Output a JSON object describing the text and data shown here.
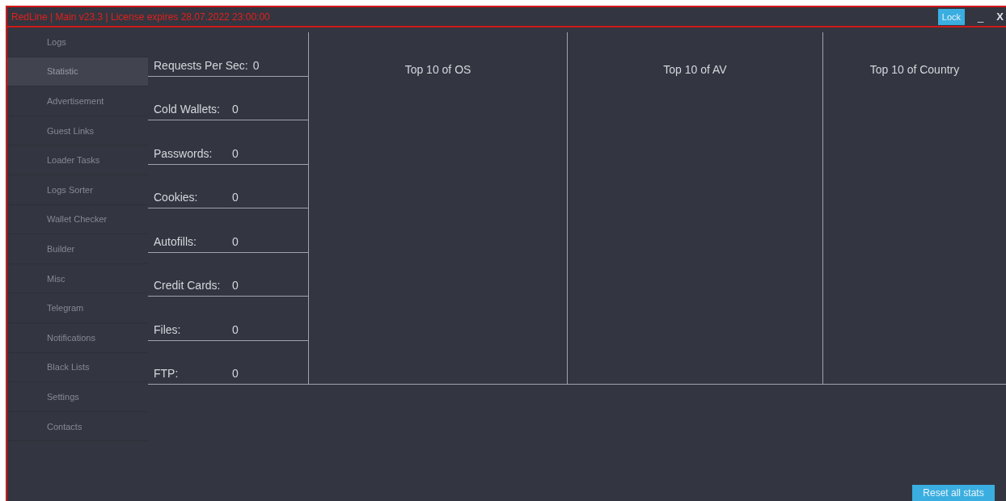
{
  "window": {
    "title": "RedLine | Main v23.3 | License expires 28.07.2022 23:00:00",
    "buttons": [
      {
        "kind": "lock",
        "label": "Lock"
      },
      {
        "kind": "minimize",
        "label": "_"
      },
      {
        "kind": "close",
        "label": "X"
      }
    ]
  },
  "sidebar": {
    "items": [
      {
        "label": "Logs",
        "selected": false
      },
      {
        "label": "Statistic",
        "selected": true
      },
      {
        "label": "Advertisement",
        "selected": false
      },
      {
        "label": "Guest Links",
        "selected": false
      },
      {
        "label": "Loader Tasks",
        "selected": false
      },
      {
        "label": "Logs Sorter",
        "selected": false
      },
      {
        "label": "Wallet Checker",
        "selected": false
      },
      {
        "label": "Builder",
        "selected": false
      },
      {
        "label": "Misc",
        "selected": false
      },
      {
        "label": "Telegram",
        "selected": false
      },
      {
        "label": "Notifications",
        "selected": false
      },
      {
        "label": "Black Lists",
        "selected": false
      },
      {
        "label": "Settings",
        "selected": false
      },
      {
        "label": "Contacts",
        "selected": false
      }
    ]
  },
  "stats": [
    {
      "label": "Requests Per Sec:",
      "value": "0"
    },
    {
      "label": "Cold Wallets:",
      "value": "0"
    },
    {
      "label": "Passwords:",
      "value": "0"
    },
    {
      "label": "Cookies:",
      "value": "0"
    },
    {
      "label": "Autofills:",
      "value": "0"
    },
    {
      "label": "Credit Cards:",
      "value": "0"
    },
    {
      "label": "Files:",
      "value": "0"
    },
    {
      "label": "FTP:",
      "value": "0"
    }
  ],
  "panels": [
    {
      "title": "Top 10 of OS"
    },
    {
      "title": "Top 10 of AV"
    },
    {
      "title": "Top 10 of Country"
    }
  ],
  "footer": {
    "button": "Reset all stats"
  }
}
